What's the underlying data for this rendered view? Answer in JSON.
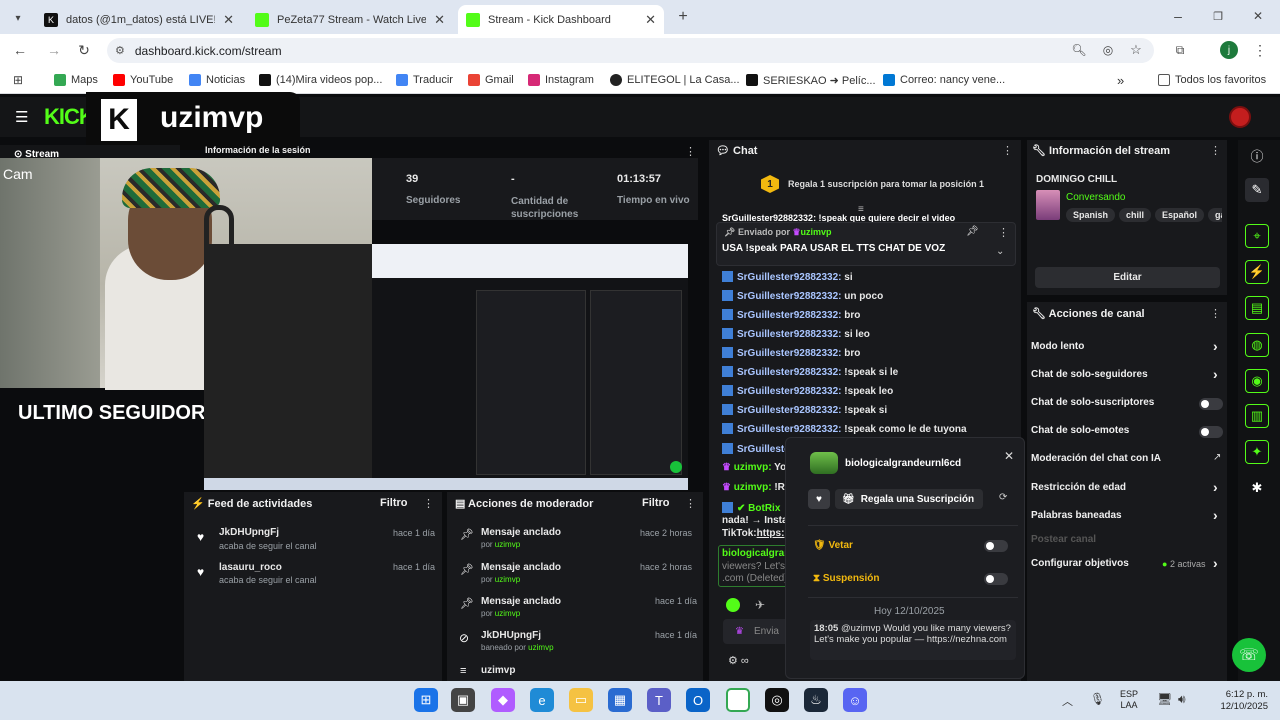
{
  "browser": {
    "tabs": [
      {
        "title": "datos (@1m_datos) está LIVE! T",
        "close": "✕"
      },
      {
        "title": "PeZeta77 Stream - Watch Live o",
        "close": "✕"
      },
      {
        "title": "Stream - Kick Dashboard",
        "close": "✕"
      }
    ],
    "new_tab": "+",
    "url": "dashboard.kick.com/stream",
    "profile_initial": "j",
    "bookmarks": [
      "Maps",
      "YouTube",
      "Noticias",
      "(14)Mira videos pop...",
      "Traducir",
      "Gmail",
      "Instagram",
      "ELITEGOL | La Casa...",
      "SERIESKAO ➜ Pelíc...",
      "Correo: nancy vene..."
    ],
    "bookmarks_more": "»",
    "all_favorites": "Todos los favoritos"
  },
  "overlay": {
    "brand": "uzimvp",
    "cam_label": "Cam",
    "last_follower": "ULTIMO SEGUIDOR: JkDHUpngFj"
  },
  "nav": {
    "logo": "KICK",
    "stream_tab": "Stream",
    "session_title": "Información de la sesión"
  },
  "stats": [
    {
      "value": "39",
      "label": "Seguidores"
    },
    {
      "value": "-",
      "label": "Cantidad de suscripciones"
    },
    {
      "value": "01:13:57",
      "label": "Tiempo en vivo"
    }
  ],
  "activity_feed": {
    "title": "Feed de actividades",
    "filter": "Filtro",
    "items": [
      {
        "user": "JkDHUpngFj",
        "text": "acaba de seguir el canal",
        "time": "hace 1 día"
      },
      {
        "user": "lasauru_roco",
        "text": "acaba de seguir el canal",
        "time": "hace 1 día"
      }
    ]
  },
  "moderator_actions": {
    "title": "Acciones de moderador",
    "filter": "Filtro",
    "items": [
      {
        "action": "Mensaje anclado",
        "by": "por",
        "user": "uzimvp",
        "time": "hace 2 horas"
      },
      {
        "action": "Mensaje anclado",
        "by": "por",
        "user": "uzimvp",
        "time": "hace 2 horas"
      },
      {
        "action": "Mensaje anclado",
        "by": "por",
        "user": "uzimvp",
        "time": "hace 1 día"
      },
      {
        "action": "JkDHUpngFj",
        "by": "baneado por",
        "user": "uzimvp",
        "time": "hace 1 día"
      },
      {
        "action": "uzimvp",
        "by": "",
        "user": "",
        "time": ""
      }
    ]
  },
  "chat": {
    "title": "Chat",
    "promo": "Regala 1 suscripción para tomar la posición 1",
    "promo_badge": "1",
    "pinned_by_label": "Enviado por",
    "pinned_by": "uzimvp",
    "pinned_text": "USA !speak PARA USAR EL TTS CHAT DE VOZ",
    "partial_top": "SrGuillester92882332: !speak que quiere decir el video",
    "messages": [
      {
        "user": "SrGuillester92882332:",
        "text": "si"
      },
      {
        "user": "SrGuillester92882332:",
        "text": "un poco"
      },
      {
        "user": "SrGuillester92882332:",
        "text": "bro"
      },
      {
        "user": "SrGuillester92882332:",
        "text": "si leo"
      },
      {
        "user": "SrGuillester92882332:",
        "text": "bro"
      },
      {
        "user": "SrGuillester92882332:",
        "text": "!speak si le"
      },
      {
        "user": "SrGuillester92882332:",
        "text": "!speak leo"
      },
      {
        "user": "SrGuillester92882332:",
        "text": "!speak si"
      },
      {
        "user": "SrGuillester92882332:",
        "text": "!speak como le de tuyona"
      },
      {
        "user": "SrGuillester",
        "text": ""
      }
    ],
    "owner_lines": [
      {
        "user": "uzimvp:",
        "text": "Yo"
      },
      {
        "user": "uzimvp:",
        "text": "!R"
      }
    ],
    "bot": {
      "user": "BotRix",
      "line1": "nada! → Instag",
      "line2": "TikTok:",
      "link": "https:"
    },
    "deleted": {
      "user": "biologicalgrar",
      "line1": "viewers? Let's",
      "line2": ".com (Deleted)"
    },
    "send_placeholder": "Envia"
  },
  "user_popup": {
    "username": "biologicalgrandeurnl6cd",
    "close": "✕",
    "gift_button": "Regala una Suscripción",
    "veto": "Vetar",
    "suspension": "Suspensión",
    "date": "Hoy 12/10/2025",
    "msg_time": "18:05",
    "msg_text": "@uzimvp Would you like many viewers? Let's make you popular — https://nezhna.com"
  },
  "stream_info": {
    "title": "Información del stream",
    "stream_title": "DOMINGO CHILL",
    "category": "Conversando",
    "tags": [
      "Spanish",
      "chill",
      "Español",
      "gam"
    ],
    "edit": "Editar"
  },
  "channel_actions": {
    "title": "Acciones de canal",
    "items": [
      {
        "label": "Modo lento",
        "control": "chevron"
      },
      {
        "label": "Chat de solo-seguidores",
        "control": "chevron"
      },
      {
        "label": "Chat de solo-suscriptores",
        "control": "toggle"
      },
      {
        "label": "Chat de solo-emotes",
        "control": "toggle"
      },
      {
        "label": "Moderación del chat con IA",
        "control": "external"
      },
      {
        "label": "Restricción de edad",
        "control": "chevron"
      },
      {
        "label": "Palabras baneadas",
        "control": "chevron"
      },
      {
        "label": "Postear canal",
        "control": "none"
      },
      {
        "label": "Configurar objetivos",
        "control": "chevron"
      }
    ],
    "goals_active": "2 activas"
  },
  "taskbar": {
    "lang": "ESP",
    "region": "LAA",
    "time": "6:12 p. m.",
    "date": "12/10/2025"
  },
  "colors": {
    "kick_green": "#53fc18",
    "panel": "#18191c",
    "bg": "#0b0c0e"
  }
}
